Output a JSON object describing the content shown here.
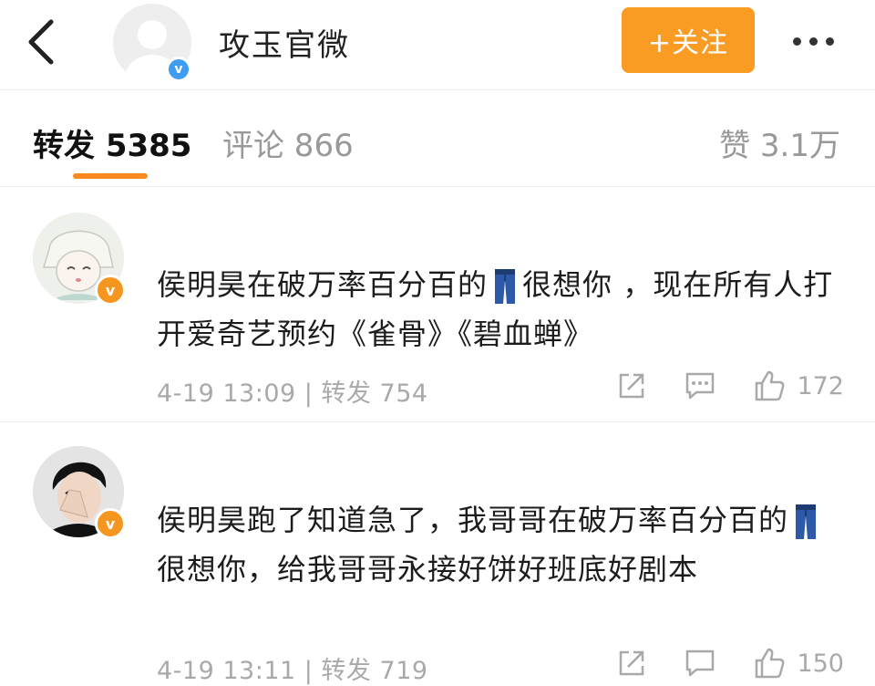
{
  "header": {
    "account_name": "攻玉官微",
    "verified_badge": "v",
    "follow_label": "+关注"
  },
  "tabs": {
    "repost": "转发 5385",
    "comment": "评论 866",
    "like": "赞 3.1万"
  },
  "colors": {
    "follow_button": "#fa9c24",
    "tab_underline": "#fa8a1e",
    "verified_blue": "#3f9cf0",
    "verified_orange": "#f5961e"
  },
  "posts": [
    {
      "text_before_emoji": "侯明昊在破万率百分百的",
      "emoji": "jeans-icon",
      "text_after_emoji": "很想你 ，现在所有人打开爱奇艺预约《雀骨》《碧血蝉》",
      "meta": "4-19 13:09 | 转发 754",
      "like_count": "172"
    },
    {
      "text_before_emoji": "侯明昊跑了知道急了，我哥哥在破万率百分百的",
      "emoji": "jeans-icon",
      "text_after_emoji": "很想你，给我哥哥永接好饼好班底好剧本",
      "meta": "4-19 13:11 | 转发 719",
      "like_count": "150"
    }
  ]
}
